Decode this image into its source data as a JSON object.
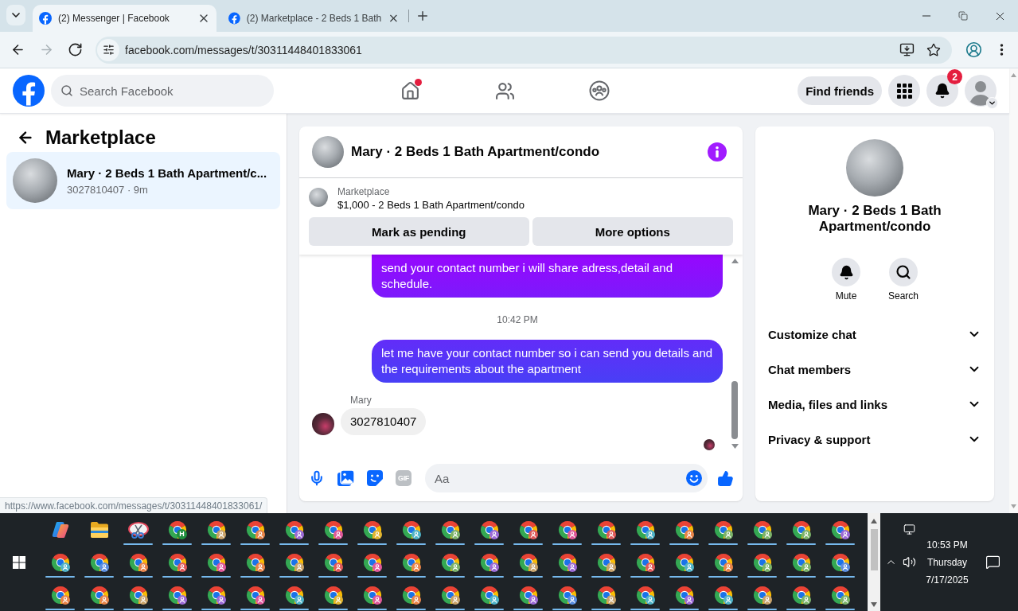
{
  "browser": {
    "tabs": [
      {
        "title": "(2) Messenger | Facebook",
        "selected": true
      },
      {
        "title": "(2) Marketplace - 2 Beds 1 Bath",
        "selected": false
      }
    ],
    "nav_buttons": [
      {
        "kind": "back",
        "disabled": false
      },
      {
        "kind": "forward",
        "disabled": true
      },
      {
        "kind": "reload",
        "disabled": false
      }
    ],
    "address": "facebook.com/messages/t/30311448401833061",
    "status_url": "https://www.facebook.com/messages/t/30311448401833061/"
  },
  "header": {
    "search_placeholder": "Search Facebook",
    "nav": [
      {
        "kind": "home",
        "dot": true
      },
      {
        "kind": "friends",
        "dot": false
      },
      {
        "kind": "groups",
        "dot": false
      }
    ],
    "find_friends": "Find friends",
    "notification_count": "2"
  },
  "sidebar": {
    "title": "Marketplace",
    "threads": [
      {
        "title": "Mary · 2 Beds 1 Bath Apartment/c...",
        "subtitle": "3027810407 · 9m",
        "selected": true
      }
    ]
  },
  "chat": {
    "title": "Mary · 2 Beds 1 Bath Apartment/condo",
    "listing": {
      "label": "Marketplace",
      "summary": "$1,000 - 2 Beds 1 Bath Apartment/condo",
      "actions": [
        "Mark as pending",
        "More options"
      ]
    },
    "messages": [
      {
        "kind": "outgoing",
        "text": "send your contact number i will share adress,detail and schedule."
      },
      {
        "kind": "time",
        "text": "10:42 PM"
      },
      {
        "kind": "outgoing",
        "text": "let me have your contact number so i can send you details and the requirements about the apartment"
      },
      {
        "kind": "incoming",
        "sender": "Mary",
        "text": "3027810407"
      }
    ],
    "seen": true,
    "composer": {
      "gif_label": "GIF",
      "placeholder": "Aa"
    }
  },
  "details": {
    "title": "Mary · 2 Beds 1 Bath Apartment/condo",
    "actions": [
      {
        "kind": "mute",
        "label": "Mute"
      },
      {
        "kind": "search",
        "label": "Search"
      }
    ],
    "sections": [
      {
        "label": "Customize chat",
        "expanded": false
      },
      {
        "label": "Chat members",
        "expanded": false
      },
      {
        "label": "Media, files and links",
        "expanded": false
      },
      {
        "label": "Privacy & support",
        "expanded": false
      }
    ]
  },
  "taskbar": {
    "apps": [
      {
        "kind": "assistant",
        "running": false
      },
      {
        "kind": "folder",
        "running": false
      },
      {
        "kind": "snip",
        "running": true
      },
      {
        "kind": "browser",
        "color": "#1e8e3e",
        "badge": "H",
        "running": true
      },
      {
        "kind": "browser",
        "color": "#c9a36b",
        "running": true
      },
      {
        "kind": "browser",
        "color": "#e8844a",
        "running": true
      },
      {
        "kind": "browser",
        "color": "#9c6ad6",
        "running": true
      },
      {
        "kind": "browser",
        "color": "#e0589a",
        "running": true
      },
      {
        "kind": "browser",
        "color": "#e2b530",
        "running": true
      },
      {
        "kind": "browser",
        "color": "#4fb3c8",
        "running": true
      },
      {
        "kind": "browser",
        "color": "#7cb36a",
        "running": true
      },
      {
        "kind": "browser",
        "color": "#9c6ad6",
        "running": true
      },
      {
        "kind": "browser",
        "color": "#e05a5a",
        "running": true
      },
      {
        "kind": "browser",
        "color": "#e0589a",
        "running": true
      },
      {
        "kind": "browser",
        "color": "#e05a5a",
        "running": true
      },
      {
        "kind": "browser",
        "color": "#4fb3c8",
        "running": true
      },
      {
        "kind": "browser",
        "color": "#e8844a",
        "running": true
      },
      {
        "kind": "browser",
        "color": "#7cb36a",
        "running": true
      },
      {
        "kind": "browser",
        "color": "#7cb36a",
        "running": true
      },
      {
        "kind": "browser",
        "color": "#7cb36a",
        "running": true
      },
      {
        "kind": "browser",
        "color": "#9c6ad6",
        "running": true
      },
      {
        "kind": "browser",
        "color": "#4fb3c8",
        "running": true
      },
      {
        "kind": "browser",
        "color": "#5b8ee0",
        "running": true
      },
      {
        "kind": "browser",
        "color": "#e8844a",
        "running": true
      },
      {
        "kind": "browser",
        "color": "#e05a5a",
        "running": true
      },
      {
        "kind": "browser",
        "color": "#e0589a",
        "running": true
      },
      {
        "kind": "browser",
        "color": "#e8844a",
        "running": true
      },
      {
        "kind": "browser",
        "color": "#c9a36b",
        "running": true
      },
      {
        "kind": "browser",
        "color": "#e05a5a",
        "running": true
      },
      {
        "kind": "browser",
        "color": "#e0589a",
        "running": true
      },
      {
        "kind": "browser",
        "color": "#e8844a",
        "running": true
      },
      {
        "kind": "browser",
        "color": "#7cb36a",
        "running": true
      },
      {
        "kind": "browser",
        "color": "#9c6ad6",
        "running": true
      },
      {
        "kind": "browser",
        "color": "#c9a36b",
        "running": true
      },
      {
        "kind": "browser",
        "color": "#9c6ad6",
        "running": true
      },
      {
        "kind": "browser",
        "color": "#c9a36b",
        "running": true
      },
      {
        "kind": "browser",
        "color": "#e05a5a",
        "running": true
      },
      {
        "kind": "browser",
        "color": "#4fb3c8",
        "running": true
      },
      {
        "kind": "browser",
        "color": "#e8844a",
        "running": true
      },
      {
        "kind": "browser",
        "color": "#7cb36a",
        "running": true
      },
      {
        "kind": "browser",
        "color": "#7cb36a",
        "running": true
      },
      {
        "kind": "browser",
        "color": "#5b8ee0",
        "running": true
      },
      {
        "kind": "browser",
        "color": "#e8844a",
        "running": true
      },
      {
        "kind": "browser",
        "color": "#e8844a",
        "running": true
      },
      {
        "kind": "browser",
        "color": "#c9a36b",
        "running": true
      },
      {
        "kind": "browser",
        "color": "#9c6ad6",
        "running": true
      },
      {
        "kind": "browser",
        "color": "#9c6ad6",
        "running": true
      },
      {
        "kind": "browser",
        "color": "#e0589a",
        "running": true
      },
      {
        "kind": "browser",
        "color": "#4fb3c8",
        "running": true
      },
      {
        "kind": "browser",
        "color": "#e2b530",
        "running": true
      },
      {
        "kind": "browser",
        "color": "#e0589a",
        "running": true
      },
      {
        "kind": "browser",
        "color": "#e8844a",
        "running": true
      },
      {
        "kind": "browser",
        "color": "#c9a36b",
        "running": true
      },
      {
        "kind": "browser",
        "color": "#4fb3c8",
        "running": true
      },
      {
        "kind": "browser",
        "color": "#9c6ad6",
        "running": true
      },
      {
        "kind": "browser",
        "color": "#5b8ee0",
        "running": true
      },
      {
        "kind": "browser",
        "color": "#c9a36b",
        "running": true
      },
      {
        "kind": "browser",
        "color": "#4fb3c8",
        "running": true
      },
      {
        "kind": "browser",
        "color": "#9c6ad6",
        "running": true
      },
      {
        "kind": "browser",
        "color": "#4fb3c8",
        "running": true
      },
      {
        "kind": "browser",
        "color": "#c9a36b",
        "running": true
      },
      {
        "kind": "browser",
        "color": "#7cb36a",
        "running": true
      },
      {
        "kind": "browser",
        "color": "#7cb36a",
        "running": true
      }
    ],
    "clock": {
      "time": "10:53 PM",
      "day": "Thursday",
      "date": "7/17/2025"
    }
  }
}
